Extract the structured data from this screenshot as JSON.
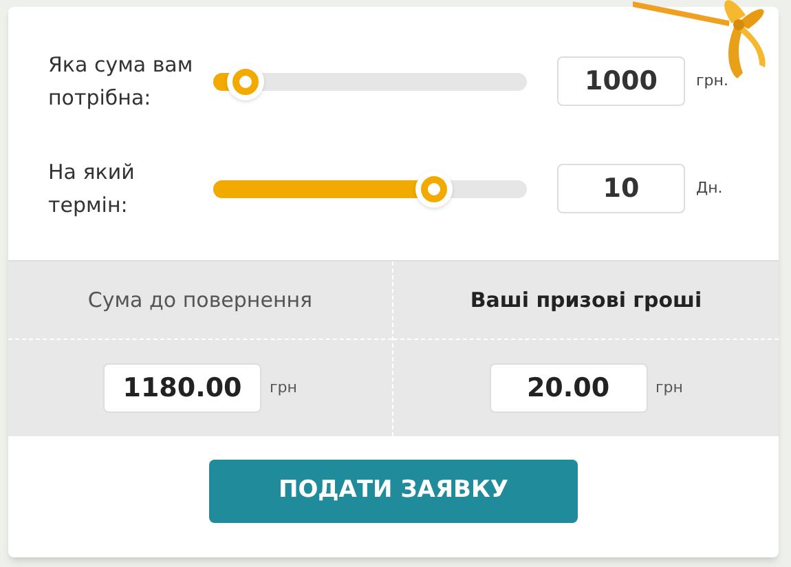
{
  "sliders": [
    {
      "label": "Яка сума вам потрібна:",
      "level": 0.1,
      "value": "1000",
      "unit": "грн."
    },
    {
      "label": "На який термін:",
      "level": 0.7,
      "value": "10",
      "unit": "Дн."
    }
  ],
  "summary": [
    {
      "heading": "Сума до повернення",
      "bold": false,
      "value": "1180.00",
      "unit": "грн"
    },
    {
      "heading": "Ваші призові гроші",
      "bold": true,
      "value": "20.00",
      "unit": "грн"
    }
  ],
  "submit": "ПОДАТИ ЗАЯВКУ"
}
